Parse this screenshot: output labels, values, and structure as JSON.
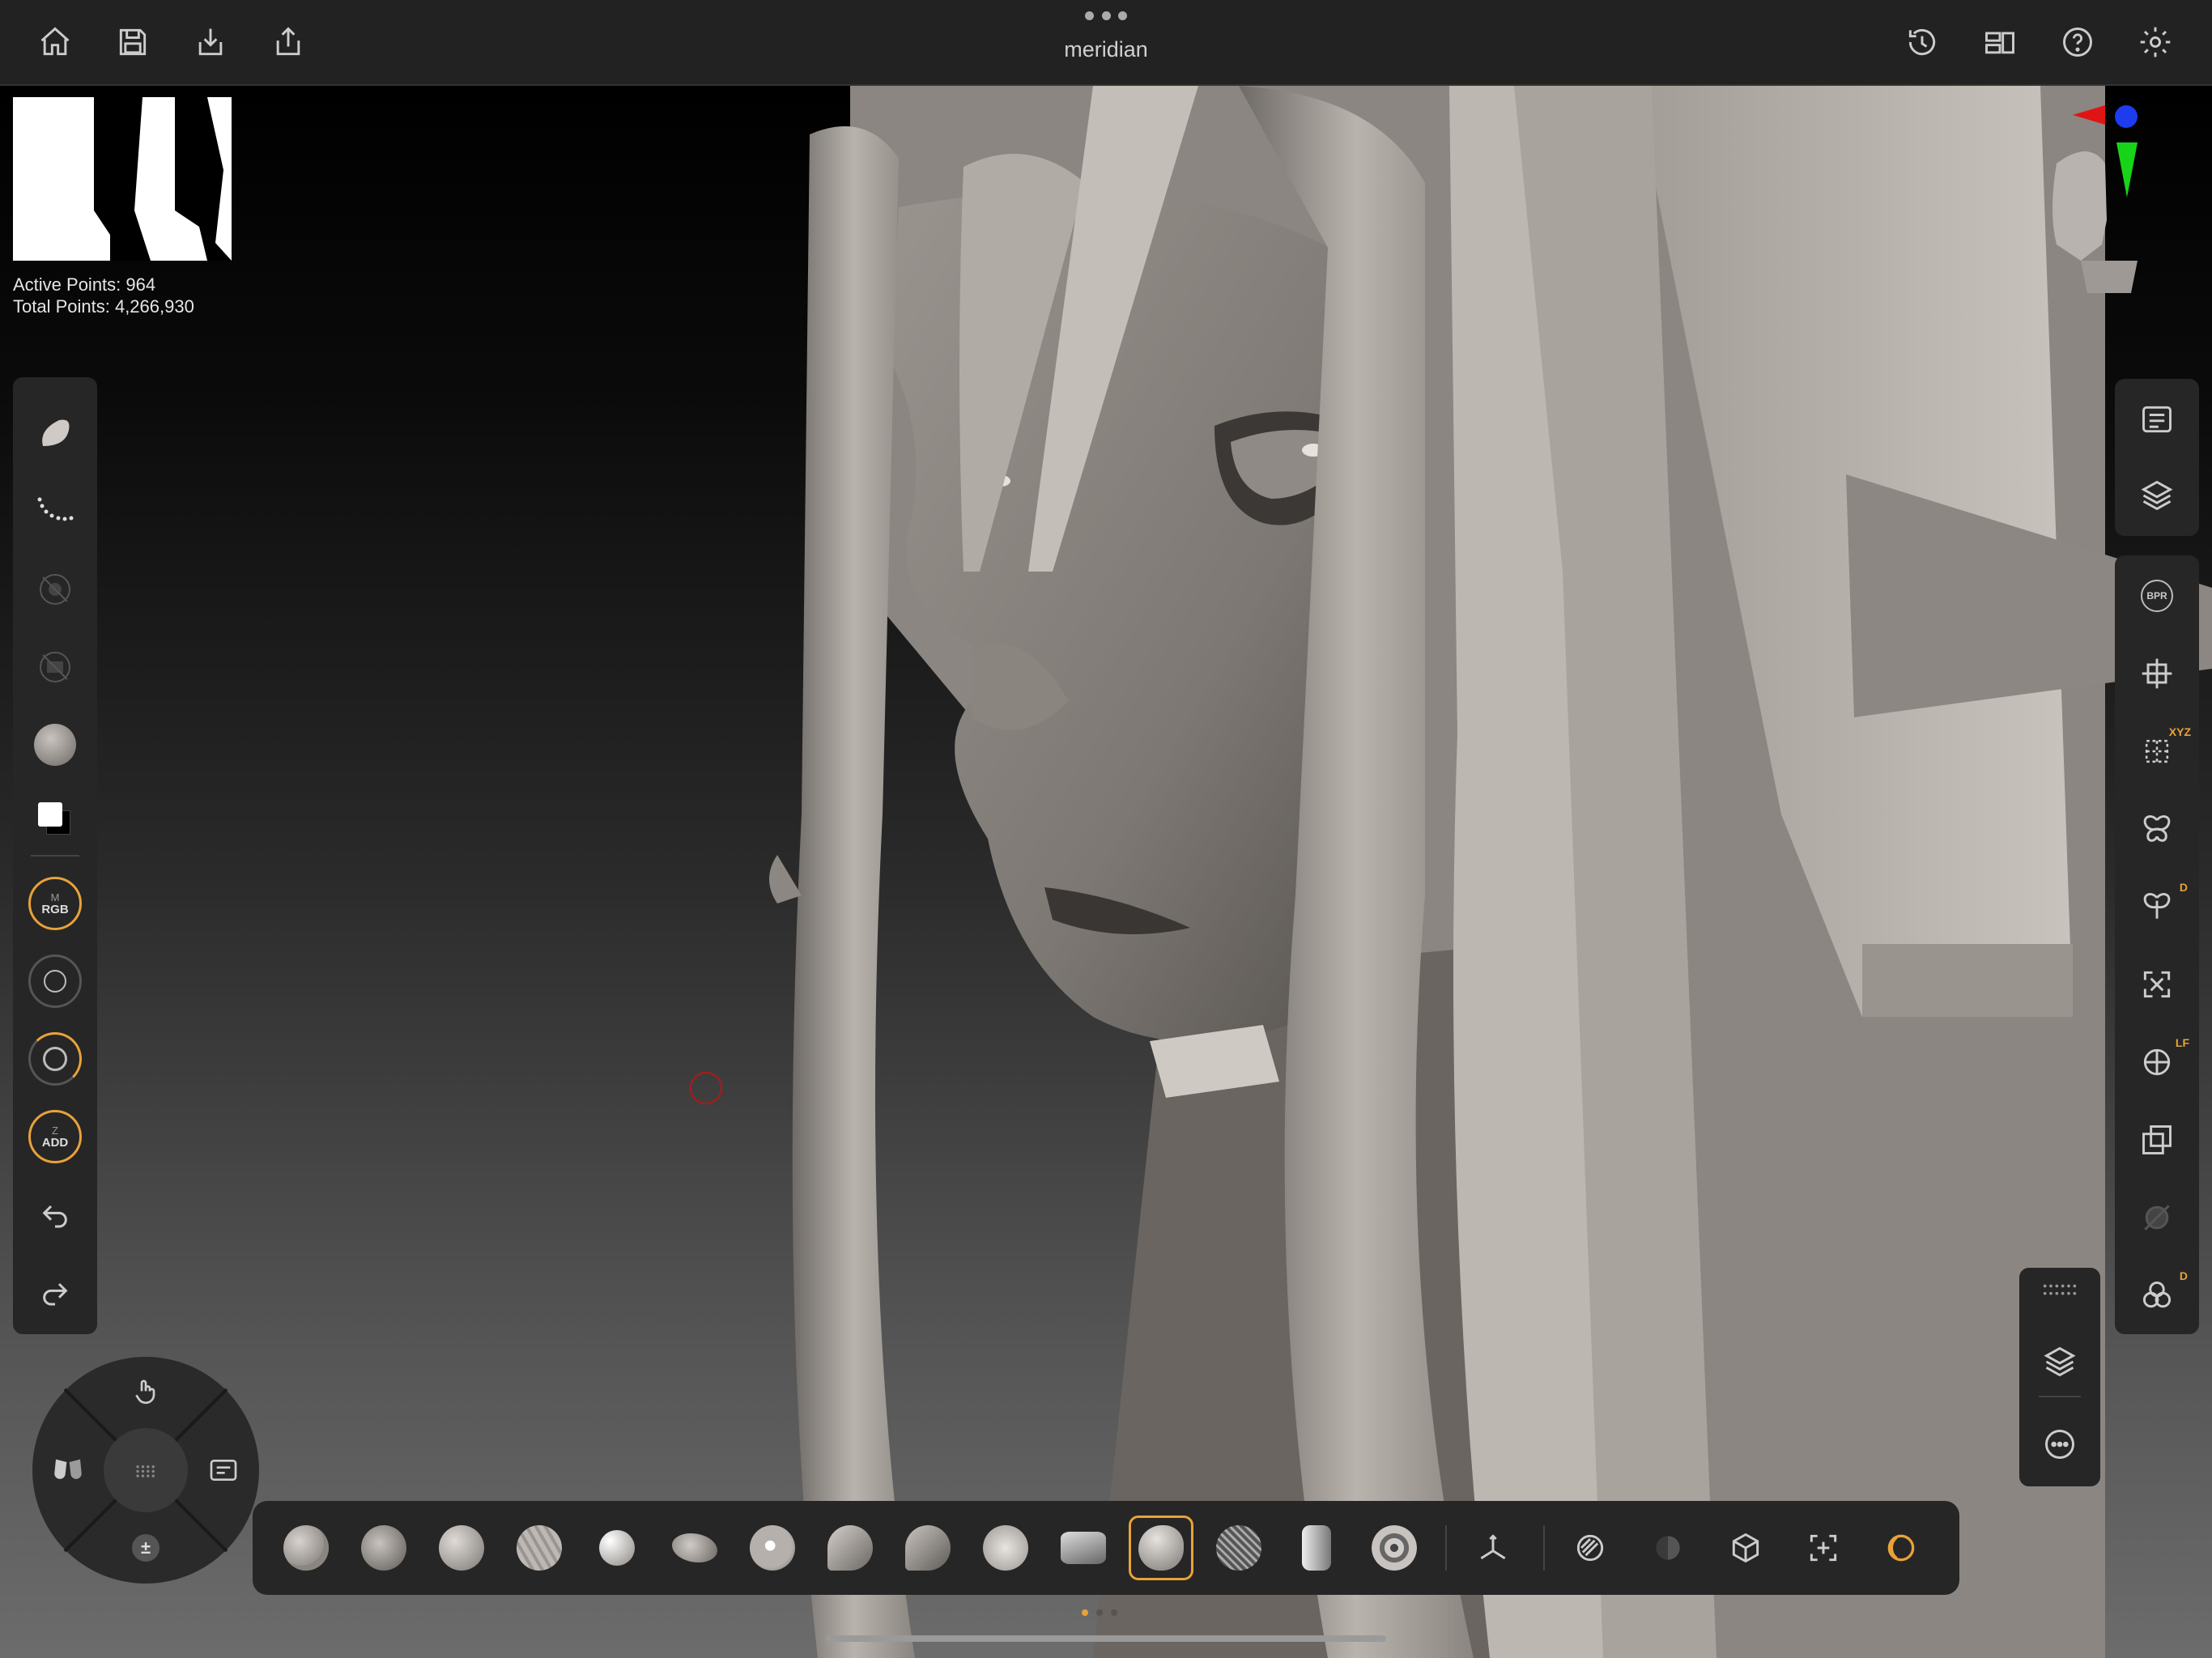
{
  "app": {
    "document_title": "meridian"
  },
  "top_bar": {
    "left_icons": [
      "home-icon",
      "save-icon",
      "import-icon",
      "share-icon"
    ],
    "right_icons": [
      "history-icon",
      "layout-icon",
      "help-icon",
      "settings-icon"
    ]
  },
  "stats": {
    "active_points": "Active Points: 964",
    "total_points": "Total Points: 4,266,930"
  },
  "left_toolbar": {
    "items": [
      "brush-preview-icon",
      "stroke-icon",
      "alpha-off-icon",
      "texture-off-icon",
      "material-icon",
      "color-swatch-icon"
    ],
    "rgb_ring": {
      "top": "M",
      "label": "RGB"
    },
    "zadd_ring": {
      "top": "Z",
      "label": "ADD"
    },
    "undo": "undo-icon",
    "redo": "redo-icon"
  },
  "right_toolbar": {
    "top_group": [
      "subtools-list-icon",
      "layers-icon"
    ],
    "main_group": [
      "bpr-icon",
      "transform-icon",
      "symmetry-xyz-icon",
      "symmetry-icon",
      "dynamic-symmetry-icon",
      "frame-icon",
      "local-frame-icon",
      "polyframe-icon",
      "solo-icon",
      "dynamic-icon"
    ],
    "bpr_label": "BPR",
    "xyz_badge": "XYZ",
    "d_badge": "D",
    "lf_badge": "LF",
    "d_badge2": "D"
  },
  "mini_panel": {
    "items": [
      "grip-icon",
      "layers-icon",
      "more-icon"
    ]
  },
  "dial": {
    "items": [
      "gesture-icon",
      "masks-icon",
      "mode-icon",
      "plus-minus-icon",
      "menu-grid-icon"
    ]
  },
  "brush_bar": {
    "brushes": [
      "clay-buildup",
      "clay-tubes",
      "standard",
      "damstandard",
      "inflate",
      "move",
      "snakehook",
      "trim-dynamic",
      "hpolish",
      "smooth",
      "chisel",
      "standard-selected",
      "mesh-insert",
      "imm",
      "curve"
    ],
    "selected_index": 11,
    "tools": [
      "gizmo-icon",
      "mask-toggle-icon",
      "visibility-icon",
      "mesh-icon",
      "selection-icon",
      "dynamesh-icon"
    ]
  },
  "pagination": {
    "count": 3,
    "active": 0
  },
  "colors": {
    "accent": "#e8a23a",
    "panel": "#262626",
    "topbar": "#222222"
  }
}
